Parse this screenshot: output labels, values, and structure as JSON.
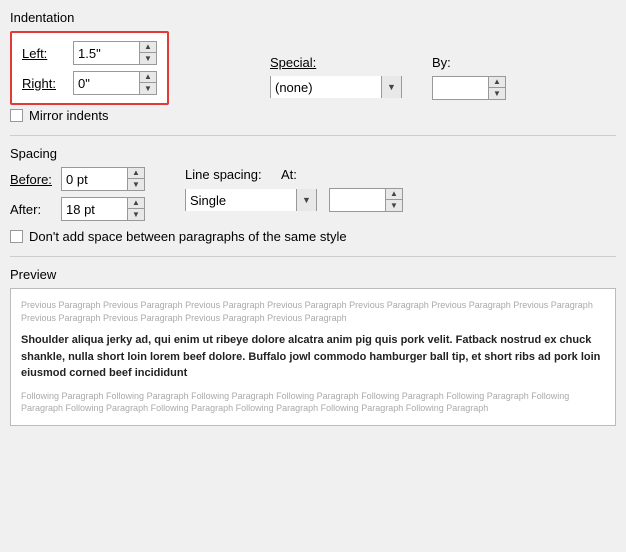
{
  "indentation": {
    "title": "Indentation",
    "left_label": "Left:",
    "left_value": "1.5\"",
    "right_label": "Right:",
    "right_value": "0\"",
    "special_label": "Special:",
    "special_value": "(none)",
    "by_label": "By:",
    "by_value": "",
    "mirror_label": "Mirror indents"
  },
  "spacing": {
    "title": "Spacing",
    "before_label": "Before:",
    "before_value": "0 pt",
    "after_label": "After:",
    "after_value": "18 pt",
    "line_spacing_label": "Line spacing:",
    "line_spacing_value": "Single",
    "at_label": "At:",
    "at_value": "",
    "dont_add_label": "Don't add space between paragraphs of the same style"
  },
  "preview": {
    "title": "Preview",
    "prev_text": "Previous Paragraph Previous Paragraph Previous Paragraph Previous Paragraph Previous Paragraph Previous Paragraph Previous Paragraph Previous Paragraph Previous Paragraph Previous Paragraph Previous Paragraph",
    "main_text": "Shoulder aliqua jerky ad, qui enim ut ribeye dolore alcatra anim pig quis pork velit. Fatback nostrud ex chuck shankle, nulla short loin lorem beef dolore. Buffalo jowl commodo hamburger ball tip, et short ribs ad pork loin eiusmod corned beef incididunt",
    "follow_text": "Following Paragraph Following Paragraph Following Paragraph Following Paragraph Following Paragraph Following Paragraph Following Paragraph Following Paragraph Following Paragraph Following Paragraph Following Paragraph Following Paragraph"
  },
  "icons": {
    "up": "▲",
    "down": "▼",
    "dropdown": "▼"
  }
}
